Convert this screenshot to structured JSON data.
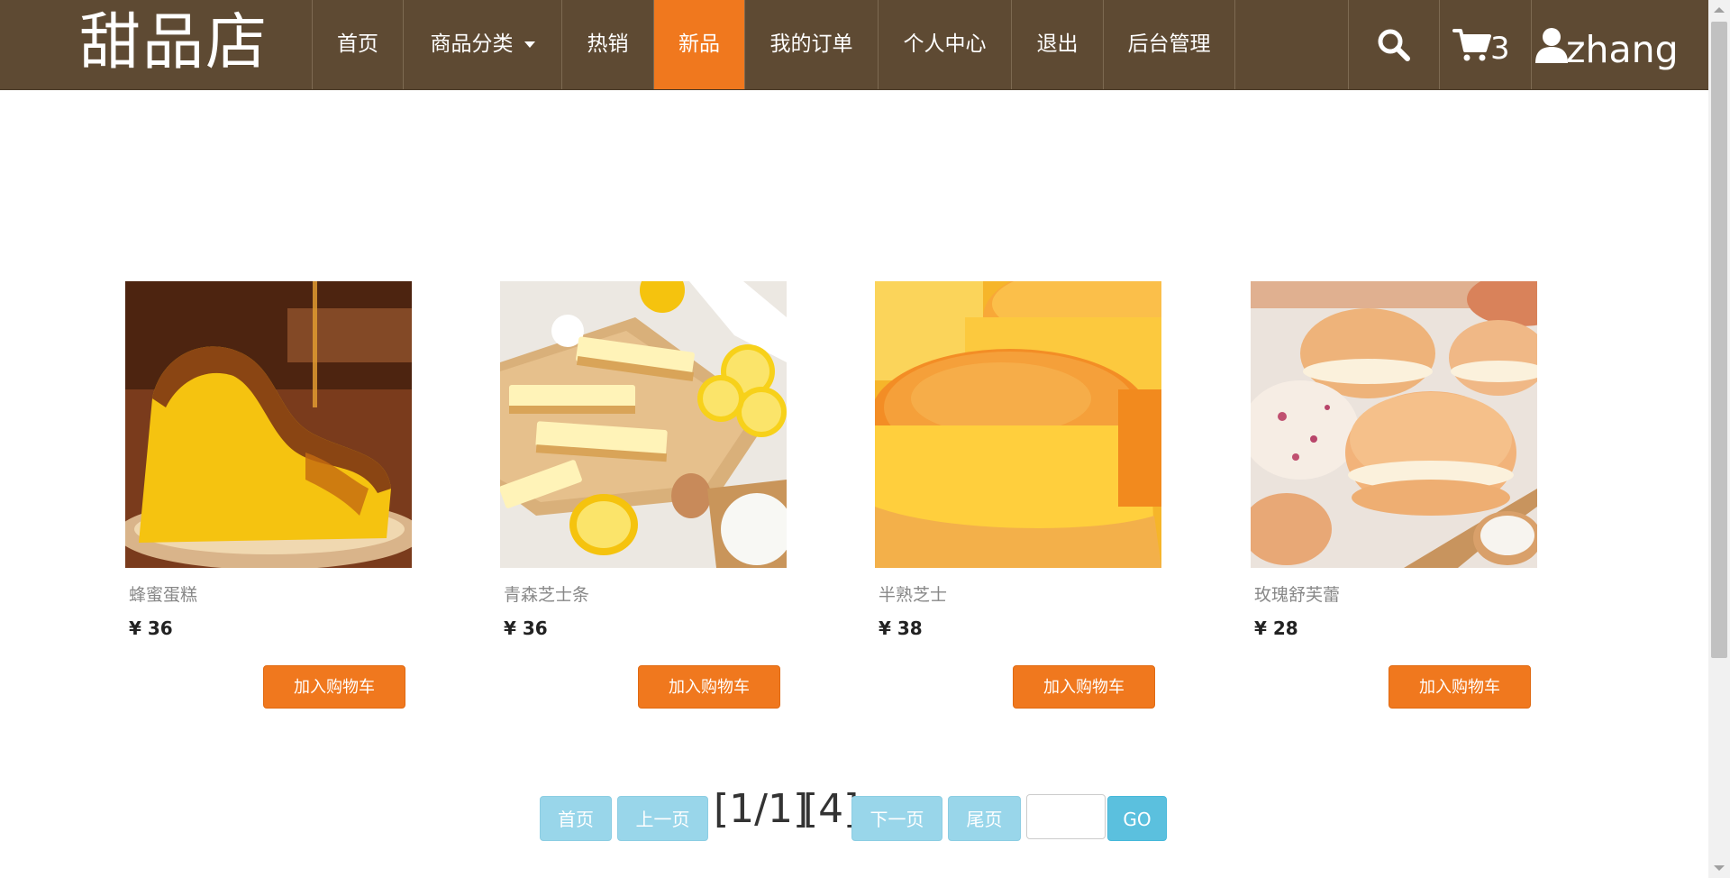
{
  "header": {
    "brand": "甜品店",
    "nav": {
      "home": "首页",
      "categories": "商品分类",
      "hot": "热销",
      "new": "新品",
      "orders": "我的订单",
      "profile": "个人中心",
      "logout": "退出",
      "admin": "后台管理"
    },
    "active_nav": "新品",
    "cart_count": "3",
    "username": "zhang",
    "icons": [
      "search-icon",
      "cart-icon",
      "user-icon"
    ]
  },
  "products": [
    {
      "name": "蜂蜜蛋糕",
      "price": "¥ 36",
      "button": "加入购物车"
    },
    {
      "name": "青森芝士条",
      "price": "¥ 36",
      "button": "加入购物车"
    },
    {
      "name": "半熟芝士",
      "price": "¥ 38",
      "button": "加入购物车"
    },
    {
      "name": "玫瑰舒芙蕾",
      "price": "¥ 28",
      "button": "加入购物车"
    }
  ],
  "pagination": {
    "first": "首页",
    "prev": "上一页",
    "page_info": "[1/1]",
    "total": "[4]",
    "next": "下一页",
    "last": "尾页",
    "jump_value": "",
    "go": "GO"
  },
  "colors": {
    "nav_bg": "#5e4a33",
    "accent": "#f0781e",
    "pager_bg": "#99d6ea",
    "go_bg": "#5bc0de"
  }
}
